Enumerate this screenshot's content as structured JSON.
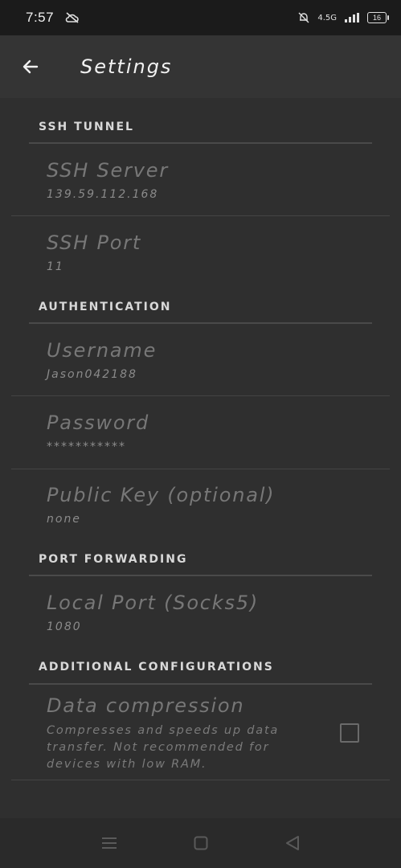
{
  "status_bar": {
    "time": "7:57",
    "network_speed": "4.5G",
    "battery_level": "16"
  },
  "app_bar": {
    "title": "Settings"
  },
  "sections": {
    "ssh_tunnel": {
      "header": "SSH TUNNEL",
      "server": {
        "title": "SSH Server",
        "value": "139.59.112.168"
      },
      "port": {
        "title": "SSH Port",
        "value": "11"
      }
    },
    "authentication": {
      "header": "AUTHENTICATION",
      "username": {
        "title": "Username",
        "value": "Jason042188"
      },
      "password": {
        "title": "Password",
        "value": "***********"
      },
      "public_key": {
        "title": "Public Key (optional)",
        "value": "none"
      }
    },
    "port_forwarding": {
      "header": "PORT FORWARDING",
      "local_port": {
        "title": "Local Port (Socks5)",
        "value": "1080"
      }
    },
    "additional": {
      "header": "ADDITIONAL CONFIGURATIONS",
      "compression": {
        "title": "Data compression",
        "description": "Compresses and speeds up data transfer. Not recommended for devices with low RAM.",
        "checked": false
      }
    }
  }
}
